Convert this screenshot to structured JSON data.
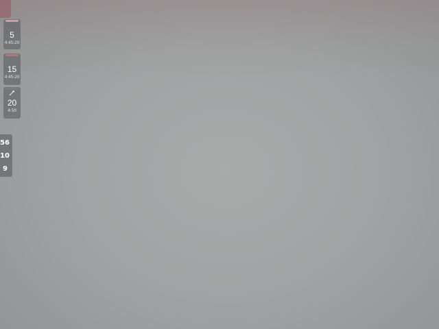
{
  "colors": {
    "background": "#a0a3a3",
    "card_bg": "#5c6062",
    "card1_accent": "#c9a0a8",
    "card2_accent": "#b07880",
    "card3_accent": "#7a7e80",
    "text": "#ffffff"
  },
  "hud": {
    "cards": [
      {
        "icon": "",
        "value": "5",
        "sub": "4:45:20"
      },
      {
        "icon": "",
        "value": "15",
        "sub": "4:45:20"
      },
      {
        "icon": "sword-icon",
        "value": "20",
        "sub": "4:50"
      }
    ],
    "counters": [
      "56",
      "10",
      "9"
    ]
  }
}
